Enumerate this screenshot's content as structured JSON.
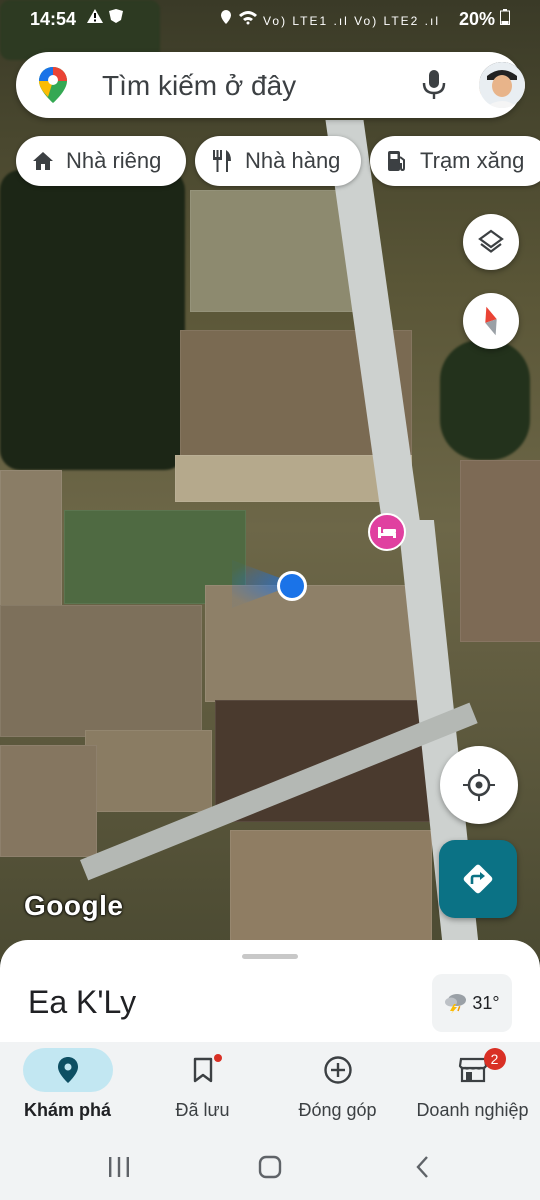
{
  "status_bar": {
    "time": "14:54",
    "battery": "20%",
    "signal_text": "Vo) LTE1 .ıl Vo) LTE2 .ıl"
  },
  "search": {
    "placeholder": "Tìm kiếm ở đây"
  },
  "chips": [
    {
      "label": "Nhà riêng",
      "icon": "home-icon"
    },
    {
      "label": "Nhà hàng",
      "icon": "restaurant-icon"
    },
    {
      "label": "Trạm xăng",
      "icon": "gas-station-icon"
    }
  ],
  "map": {
    "attribution": "Google"
  },
  "sheet": {
    "place_name": "Ea K'Ly",
    "weather_temp": "31°"
  },
  "bottom_nav": [
    {
      "label": "Khám phá",
      "icon": "explore-pin-icon",
      "active": true
    },
    {
      "label": "Đã lưu",
      "icon": "bookmark-icon",
      "active": false
    },
    {
      "label": "Đóng góp",
      "icon": "add-circle-icon",
      "active": false
    },
    {
      "label": "Doanh nghiệp",
      "icon": "store-icon",
      "active": false,
      "badge": "2"
    }
  ],
  "colors": {
    "accent": "#0b7285",
    "location_blue": "#1a73e8",
    "hotel_pin": "#e040a0",
    "badge_red": "#d93025"
  }
}
